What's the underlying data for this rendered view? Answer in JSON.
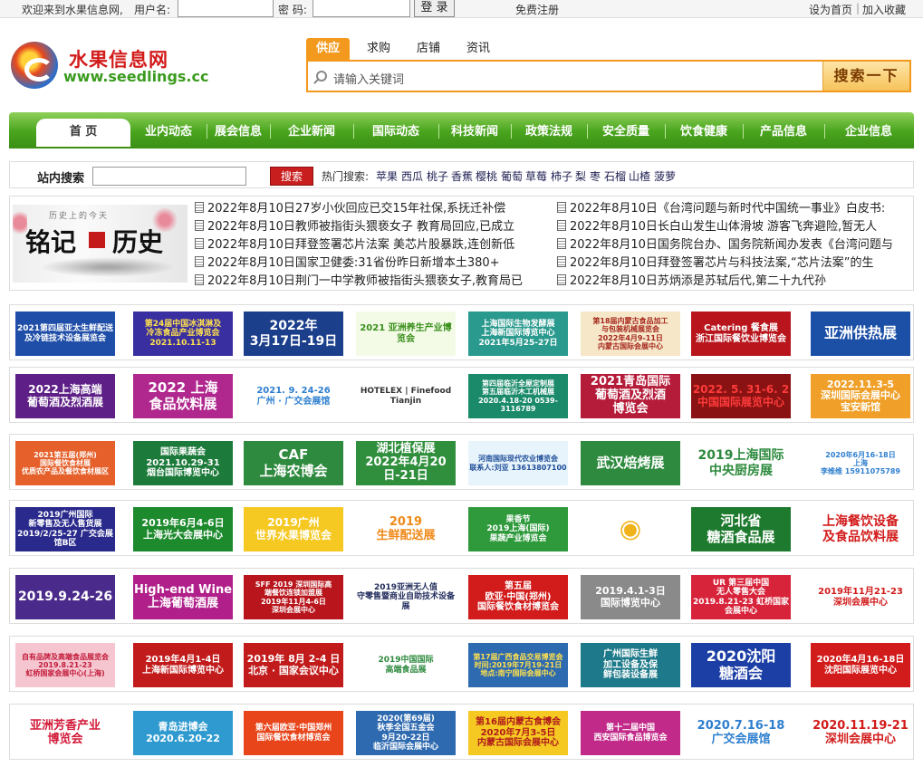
{
  "topbar": {
    "welcome": "欢迎来到水果信息网,",
    "username_label": "用户名:",
    "password_label": "密 码:",
    "login_button": "登 录",
    "register_link": "免费注册",
    "set_home_link": "设为首页",
    "divider": "|",
    "favorite_link": "加入收藏"
  },
  "logo": {
    "cn": "水果信息网",
    "en": "www.seedlings.cc"
  },
  "search_tabs": [
    {
      "label": "供应",
      "active": true
    },
    {
      "label": "求购",
      "active": false
    },
    {
      "label": "店铺",
      "active": false
    },
    {
      "label": "资讯",
      "active": false
    }
  ],
  "search": {
    "placeholder": "请输入关键词",
    "button": "搜索一下"
  },
  "nav": [
    "首 页",
    "业内动态",
    "展会信息",
    "企业新闻",
    "国际动态",
    "科技新闻",
    "政策法规",
    "安全质量",
    "饮食健康",
    "产品信息",
    "企业信息"
  ],
  "site_search": {
    "label": "站内搜索",
    "button": "搜索",
    "hot_label": "热门搜索:",
    "hot_words": [
      "苹果",
      "西瓜",
      "桃子",
      "香蕉",
      "樱桃",
      "葡萄",
      "草莓",
      "柿子",
      "梨",
      "枣",
      "石榴",
      "山楂",
      "菠萝"
    ]
  },
  "feature_image": {
    "heading": "历史上的今天",
    "text_left": "铭记",
    "text_right": "历史"
  },
  "news_left": [
    "2022年8月10日27岁小伙回应已交15年社保,系抚迁补偿",
    "2022年8月10日教师被指街头猥亵女子 教育局回应,已成立",
    "2022年8月10日拜登签署芯片法案 美芯片股暴跌,连创新低",
    "2022年8月10日国家卫健委:31省份昨日新增本土380+",
    "2022年8月10日荆门一中学教师被指街头猥亵女子,教育局已"
  ],
  "news_right": [
    "2022年8月10日《台湾问题与新时代中国统一事业》白皮书:",
    "2022年8月10日长白山发生山体滑坡 游客飞奔避险,暂无人",
    "2022年8月10日国务院台办、国务院新闻办发表《台湾问题与",
    "2022年8月10日拜登签署芯片与科技法案,“芯片法案”的生",
    "2022年8月10日苏炳添是苏轼后代,第二十九代孙"
  ],
  "ad_rows": [
    [
      {
        "text": "2021第四届亚太生鲜配送\n及冷链技术设备展览会",
        "bg": "#1f4ea8",
        "fg": "#ffffff",
        "size": 9
      },
      {
        "text": "第24届中国冰淇淋及\n冷冻食品产业博览会\n2021.10.11-13",
        "bg": "#3a2fa0",
        "fg": "#ffe14d",
        "size": 9
      },
      {
        "text": "2022年\n3月17日-19日",
        "bg": "#1c3f8c",
        "fg": "#ffffff",
        "size": 14
      },
      {
        "text": "2021 亚洲养生产业博览会",
        "bg": "#f3fbe6",
        "fg": "#3a8f1c",
        "size": 10
      },
      {
        "text": "上海国际生物发酵展\n上海新国际博览中心\n2021年5月25-27日",
        "bg": "#2a9a8e",
        "fg": "#ffffff",
        "size": 9
      },
      {
        "text": "第18届内蒙古食品加工\n与包装机械展览会\n2022年4月9-11日\n内蒙古国际会展中心",
        "bg": "#f6e7c9",
        "fg": "#a6271d",
        "size": 8
      },
      {
        "text": "Catering 餐食展\n浙江国际餐饮业博览会",
        "bg": "#b8161c",
        "fg": "#ffffff",
        "size": 10
      },
      {
        "text": "亚洲供热展",
        "bg": "#1c4fa6",
        "fg": "#ffffff",
        "size": 16
      }
    ],
    [
      {
        "text": "2022上海高端\n葡萄酒及烈酒展",
        "bg": "#5e1f86",
        "fg": "#ffffff",
        "size": 12
      },
      {
        "text": "2022 上海\n食品饮料展",
        "bg": "#b0278e",
        "fg": "#ffffff",
        "size": 15
      },
      {
        "text": "2021. 9. 24-26\n广州 · 广交会展馆",
        "bg": "#ffffff",
        "fg": "#2e7fcf",
        "size": 10
      },
      {
        "text": "HOTELEX | Finefood\nTianjin",
        "bg": "#ffffff",
        "fg": "#333333",
        "size": 9
      },
      {
        "text": "第四届临沂全屋定制展\n第五届临沂木工机械展\n2020.4.18-20  0539-3116789",
        "bg": "#1a8a6a",
        "fg": "#ffffff",
        "size": 8
      },
      {
        "text": "2021青岛国际\n葡萄酒及烈酒\n博览会",
        "bg": "#b51c3a",
        "fg": "#ffffff",
        "size": 13
      },
      {
        "text": "2022. 5. 31-6. 2\n中国国际展览中心",
        "bg": "#8a1212",
        "fg": "#ff3b3b",
        "size": 12
      },
      {
        "text": "2022.11.3-5\n深圳国际会展中心\n宝安新馆",
        "bg": "#f0a028",
        "fg": "#ffffff",
        "size": 11
      }
    ],
    [
      {
        "text": "2021第五届(郑州)\n国际餐饮食材展\n优质农产品及餐饮食材展区",
        "bg": "#e5602a",
        "fg": "#ffffff",
        "size": 8
      },
      {
        "text": "国际果蔬会\n2021.10.29-31\n烟台国际博览中心",
        "bg": "#1c7a3a",
        "fg": "#ffffff",
        "size": 10
      },
      {
        "text": "CAF\n上海农博会",
        "bg": "#2d8a3e",
        "fg": "#ffffff",
        "size": 15
      },
      {
        "text": "湖北植保展\n2022年4月20日-21日",
        "bg": "#2f8f3d",
        "fg": "#ffffff",
        "size": 13
      },
      {
        "text": "河南国际现代农业博览会\n联系人:刘亚 13613807100",
        "bg": "#e8f4fb",
        "fg": "#1f4e9a",
        "size": 8
      },
      {
        "text": "武汉焙烤展",
        "bg": "#2d8a3e",
        "fg": "#ffffff",
        "size": 15
      },
      {
        "text": "2019上海国际\n中央厨房展",
        "bg": "#ffffff",
        "fg": "#2d8a3e",
        "size": 14
      },
      {
        "text": "2020年6月16-18日\n上海\n李维维 15911075789",
        "bg": "#ffffff",
        "fg": "#2e7fcf",
        "size": 8
      }
    ],
    [
      {
        "text": "2019广州国际\n新零售及无人售货展\n2019/2/25-27 广交会展馆B区",
        "bg": "#2a2a8c",
        "fg": "#ffffff",
        "size": 9
      },
      {
        "text": "2019年6月4-6日\n上海光大会展中心",
        "bg": "#1e8a2e",
        "fg": "#ffffff",
        "size": 11
      },
      {
        "text": "2019广州\n世界水果博览会",
        "bg": "#f5c822",
        "fg": "#ffffff",
        "size": 12
      },
      {
        "text": "2019\n生鲜配送展",
        "bg": "#ffffff",
        "fg": "#f08a1a",
        "size": 13
      },
      {
        "text": "果香节\n2019上海(国际)\n果蔬产业博览会",
        "bg": "#2e9a3c",
        "fg": "#ffffff",
        "size": 9
      },
      {
        "text": "◉",
        "bg": "#ffffff",
        "fg": "#f0b21a",
        "size": 28
      },
      {
        "text": "河北省\n糖酒食品展",
        "bg": "#1e7a2e",
        "fg": "#ffffff",
        "size": 15
      },
      {
        "text": "上海餐饮设备\n及食品饮料展",
        "bg": "#ffffff",
        "fg": "#d21b1b",
        "size": 14
      }
    ],
    [
      {
        "text": "2019.9.24-26",
        "bg": "#4a2a8a",
        "fg": "#ffffff",
        "size": 14
      },
      {
        "text": "High-end Wine\n上海葡萄酒展",
        "bg": "#b01f8a",
        "fg": "#ffffff",
        "size": 13
      },
      {
        "text": "SFF 2019 深圳国际高\n端餐饮连锁加盟展\n2019年11月4-6日\n深圳会展中心",
        "bg": "#b8161c",
        "fg": "#ffffff",
        "size": 8
      },
      {
        "text": "2019亚洲无人值\n守零售暨商业自助技术设备展",
        "bg": "#ffffff",
        "fg": "#1f2a5a",
        "size": 9
      },
      {
        "text": "第五届\n欧亚·中国(郑州)\n国际餐饮食材博览会",
        "bg": "#d21b1b",
        "fg": "#ffffff",
        "size": 10
      },
      {
        "text": "2019.4.1-3日\n国际博览中心",
        "bg": "#8a8a8a",
        "fg": "#ffffff",
        "size": 11
      },
      {
        "text": "UR 第三届中国\n无人零售大会\n2019.8.21-23 虹桥国家会展中心",
        "bg": "#d8243a",
        "fg": "#ffffff",
        "size": 9
      },
      {
        "text": "2019年11月21-23\n深圳会展中心",
        "bg": "#ffffff",
        "fg": "#d21b1b",
        "size": 10
      }
    ],
    [
      {
        "text": "自有品牌及高端食品展览会\n2019.8.21-23\n虹桥国家会展中心(上海)",
        "bg": "#f6c6d0",
        "fg": "#c21b3a",
        "size": 8
      },
      {
        "text": "2019年4月1-4日\n上海新国际博览中心",
        "bg": "#c21b1b",
        "fg": "#ffffff",
        "size": 10
      },
      {
        "text": "2019年 8月 2-4 日\n北京 · 国家会议中心",
        "bg": "#c21b1b",
        "fg": "#ffffff",
        "size": 11
      },
      {
        "text": "2019中国国际\n高端食品展",
        "bg": "#ffffff",
        "fg": "#2e8a3e",
        "size": 9
      },
      {
        "text": "第17届广西食品交易博览会\n时间:2019年7月19-21日\n地点:南宁国际会展中心",
        "bg": "#2e6ab0",
        "fg": "#ffe14d",
        "size": 8
      },
      {
        "text": "广州国际生鲜\n加工设备及保\n鲜包装设备展",
        "bg": "#1e7a8a",
        "fg": "#ffffff",
        "size": 10
      },
      {
        "text": "2020沈阳\n糖酒会",
        "bg": "#1c3fa6",
        "fg": "#ffffff",
        "size": 16
      },
      {
        "text": "2020年4月16-18日\n沈阳国际展览中心",
        "bg": "#d21b1b",
        "fg": "#ffffff",
        "size": 10
      }
    ],
    [
      {
        "text": "亚洲芳香产业\n博览会",
        "bg": "#ffffff",
        "fg": "#d21b3a",
        "size": 13
      },
      {
        "text": "青岛进博会\n2020.6.20-22",
        "bg": "#2e9ad0",
        "fg": "#ffffff",
        "size": 11
      },
      {
        "text": "第六届欧亚·中国郑州\n国际餐饮食材博览会",
        "bg": "#e8451b",
        "fg": "#ffffff",
        "size": 9
      },
      {
        "text": "2020(第69届)\n秋季全国五金会\n9月20-22日\n临沂国际会展中心",
        "bg": "#2e6ab0",
        "fg": "#ffffff",
        "size": 9
      },
      {
        "text": "第16届内蒙古食博会\n2020年7月3-5日\n内蒙古国际会展中心",
        "bg": "#f5c822",
        "fg": "#b01b1b",
        "size": 10
      },
      {
        "text": "第十二届中国\n西安国际食品博览会",
        "bg": "#c22a8a",
        "fg": "#ffffff",
        "size": 9
      },
      {
        "text": "2020.7.16-18\n广交会展馆",
        "bg": "#ffffff",
        "fg": "#2e7fcf",
        "size": 13
      },
      {
        "text": "2020.11.19-21\n深圳会展中心",
        "bg": "#ffffff",
        "fg": "#d21b1b",
        "size": 13
      }
    ]
  ]
}
